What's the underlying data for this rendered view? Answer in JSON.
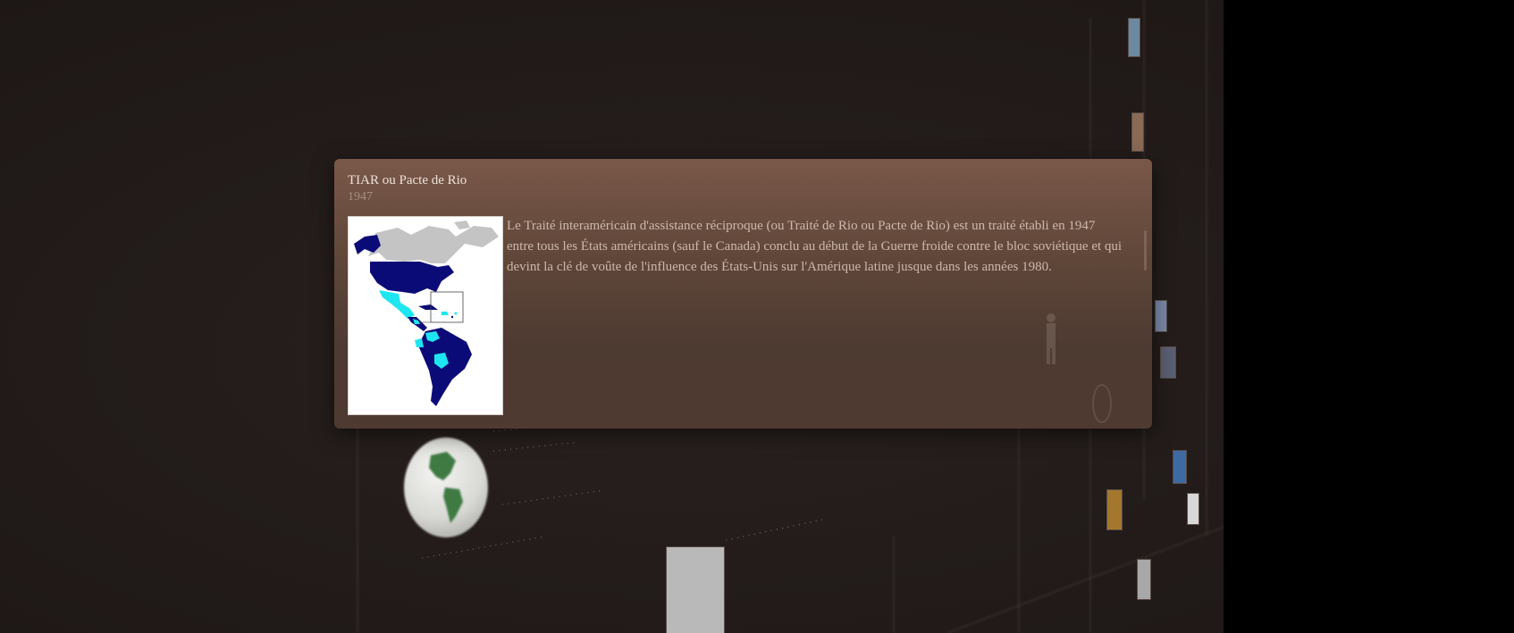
{
  "popup": {
    "title": "TIAR ou Pacte de Rio",
    "date": "1947",
    "description": "Le Traité interaméricain d'assistance réciproque (ou Traité de Rio ou Pacte de Rio) est un traité établi en 1947 entre tous les États américains (sauf le Canada) conclu au début de la Guerre froide contre le bloc soviétique et qui devint la clé de voûte de l'influence des États-Unis sur l'Amérique latine jusque dans les années 1980.",
    "image_icon": "americas-map-icon"
  },
  "colors": {
    "card_top": "#7a5849",
    "card_bottom": "#4f3a31",
    "map_members": "#0b0b78",
    "map_former_members": "#1ee6f0",
    "map_non_members": "#c4c4c4",
    "background": "#231c1a"
  }
}
